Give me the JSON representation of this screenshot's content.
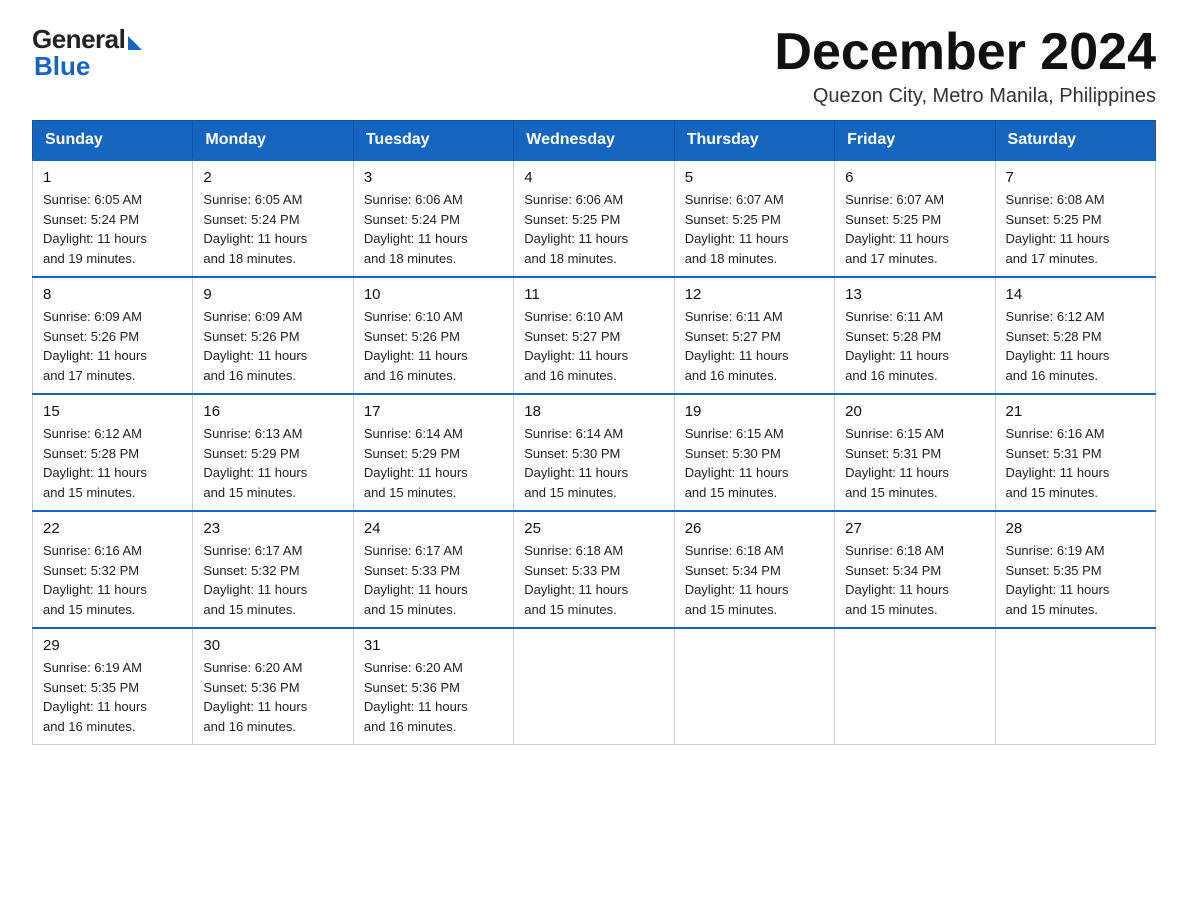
{
  "logo": {
    "general": "General",
    "blue": "Blue"
  },
  "header": {
    "month": "December 2024",
    "location": "Quezon City, Metro Manila, Philippines"
  },
  "weekdays": [
    "Sunday",
    "Monday",
    "Tuesday",
    "Wednesday",
    "Thursday",
    "Friday",
    "Saturday"
  ],
  "weeks": [
    [
      {
        "day": "1",
        "sunrise": "6:05 AM",
        "sunset": "5:24 PM",
        "daylight": "11 hours and 19 minutes."
      },
      {
        "day": "2",
        "sunrise": "6:05 AM",
        "sunset": "5:24 PM",
        "daylight": "11 hours and 18 minutes."
      },
      {
        "day": "3",
        "sunrise": "6:06 AM",
        "sunset": "5:24 PM",
        "daylight": "11 hours and 18 minutes."
      },
      {
        "day": "4",
        "sunrise": "6:06 AM",
        "sunset": "5:25 PM",
        "daylight": "11 hours and 18 minutes."
      },
      {
        "day": "5",
        "sunrise": "6:07 AM",
        "sunset": "5:25 PM",
        "daylight": "11 hours and 18 minutes."
      },
      {
        "day": "6",
        "sunrise": "6:07 AM",
        "sunset": "5:25 PM",
        "daylight": "11 hours and 17 minutes."
      },
      {
        "day": "7",
        "sunrise": "6:08 AM",
        "sunset": "5:25 PM",
        "daylight": "11 hours and 17 minutes."
      }
    ],
    [
      {
        "day": "8",
        "sunrise": "6:09 AM",
        "sunset": "5:26 PM",
        "daylight": "11 hours and 17 minutes."
      },
      {
        "day": "9",
        "sunrise": "6:09 AM",
        "sunset": "5:26 PM",
        "daylight": "11 hours and 16 minutes."
      },
      {
        "day": "10",
        "sunrise": "6:10 AM",
        "sunset": "5:26 PM",
        "daylight": "11 hours and 16 minutes."
      },
      {
        "day": "11",
        "sunrise": "6:10 AM",
        "sunset": "5:27 PM",
        "daylight": "11 hours and 16 minutes."
      },
      {
        "day": "12",
        "sunrise": "6:11 AM",
        "sunset": "5:27 PM",
        "daylight": "11 hours and 16 minutes."
      },
      {
        "day": "13",
        "sunrise": "6:11 AM",
        "sunset": "5:28 PM",
        "daylight": "11 hours and 16 minutes."
      },
      {
        "day": "14",
        "sunrise": "6:12 AM",
        "sunset": "5:28 PM",
        "daylight": "11 hours and 16 minutes."
      }
    ],
    [
      {
        "day": "15",
        "sunrise": "6:12 AM",
        "sunset": "5:28 PM",
        "daylight": "11 hours and 15 minutes."
      },
      {
        "day": "16",
        "sunrise": "6:13 AM",
        "sunset": "5:29 PM",
        "daylight": "11 hours and 15 minutes."
      },
      {
        "day": "17",
        "sunrise": "6:14 AM",
        "sunset": "5:29 PM",
        "daylight": "11 hours and 15 minutes."
      },
      {
        "day": "18",
        "sunrise": "6:14 AM",
        "sunset": "5:30 PM",
        "daylight": "11 hours and 15 minutes."
      },
      {
        "day": "19",
        "sunrise": "6:15 AM",
        "sunset": "5:30 PM",
        "daylight": "11 hours and 15 minutes."
      },
      {
        "day": "20",
        "sunrise": "6:15 AM",
        "sunset": "5:31 PM",
        "daylight": "11 hours and 15 minutes."
      },
      {
        "day": "21",
        "sunrise": "6:16 AM",
        "sunset": "5:31 PM",
        "daylight": "11 hours and 15 minutes."
      }
    ],
    [
      {
        "day": "22",
        "sunrise": "6:16 AM",
        "sunset": "5:32 PM",
        "daylight": "11 hours and 15 minutes."
      },
      {
        "day": "23",
        "sunrise": "6:17 AM",
        "sunset": "5:32 PM",
        "daylight": "11 hours and 15 minutes."
      },
      {
        "day": "24",
        "sunrise": "6:17 AM",
        "sunset": "5:33 PM",
        "daylight": "11 hours and 15 minutes."
      },
      {
        "day": "25",
        "sunrise": "6:18 AM",
        "sunset": "5:33 PM",
        "daylight": "11 hours and 15 minutes."
      },
      {
        "day": "26",
        "sunrise": "6:18 AM",
        "sunset": "5:34 PM",
        "daylight": "11 hours and 15 minutes."
      },
      {
        "day": "27",
        "sunrise": "6:18 AM",
        "sunset": "5:34 PM",
        "daylight": "11 hours and 15 minutes."
      },
      {
        "day": "28",
        "sunrise": "6:19 AM",
        "sunset": "5:35 PM",
        "daylight": "11 hours and 15 minutes."
      }
    ],
    [
      {
        "day": "29",
        "sunrise": "6:19 AM",
        "sunset": "5:35 PM",
        "daylight": "11 hours and 16 minutes."
      },
      {
        "day": "30",
        "sunrise": "6:20 AM",
        "sunset": "5:36 PM",
        "daylight": "11 hours and 16 minutes."
      },
      {
        "day": "31",
        "sunrise": "6:20 AM",
        "sunset": "5:36 PM",
        "daylight": "11 hours and 16 minutes."
      },
      null,
      null,
      null,
      null
    ]
  ],
  "labels": {
    "sunrise": "Sunrise:",
    "sunset": "Sunset:",
    "daylight": "Daylight:"
  }
}
